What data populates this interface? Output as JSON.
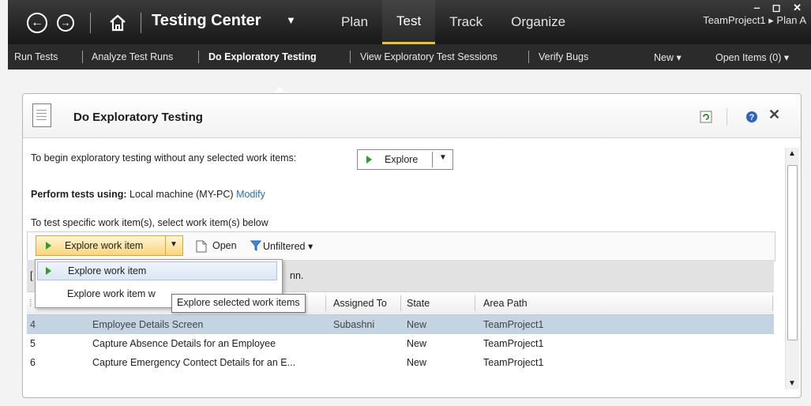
{
  "app": {
    "title": "Testing Center",
    "tabs": [
      "Plan",
      "Test",
      "Track",
      "Organize"
    ],
    "active_tab": "Test",
    "project": "TeamProject1 ▸ Plan A"
  },
  "subnav": {
    "items": [
      "Run Tests",
      "Analyze Test Runs",
      "Do Exploratory Testing",
      "View Exploratory Test Sessions",
      "Verify Bugs"
    ],
    "new_label": "New ▾",
    "open_items_label": "Open Items (0) ▾"
  },
  "panel": {
    "title": "Do Exploratory Testing",
    "begin_text": "To begin exploratory testing without any selected work items:",
    "explore_label": "Explore",
    "perform_label": "Perform tests using:",
    "perform_value": "Local machine (MY-PC)",
    "modify_link": "Modify",
    "specific_text": "To test specific work item(s), select work item(s) below"
  },
  "toolbar": {
    "explore_work_item": "Explore work item",
    "open_label": "Open",
    "filter_label": "Unfiltered ▾"
  },
  "menu": {
    "items": [
      "Explore work item",
      "Explore work item w"
    ],
    "tooltip": "Explore selected work items"
  },
  "grid": {
    "group_partial": "nn.",
    "columns": [
      "Assigned To",
      "State",
      "Area Path"
    ],
    "rows": [
      {
        "id": "4",
        "title": "Employee Details Screen",
        "assigned": "Subashni",
        "state": "New",
        "area": "TeamProject1"
      },
      {
        "id": "5",
        "title": "Capture Absence Details for an Employee",
        "assigned": "",
        "state": "New",
        "area": "TeamProject1"
      },
      {
        "id": "6",
        "title": "Capture Emergency Contect Details for an E...",
        "assigned": "",
        "state": "New",
        "area": "TeamProject1"
      }
    ]
  },
  "colors": {
    "accent": "#f0c419",
    "link": "#1c6fc7",
    "selected_row": "#c4d4e2"
  }
}
